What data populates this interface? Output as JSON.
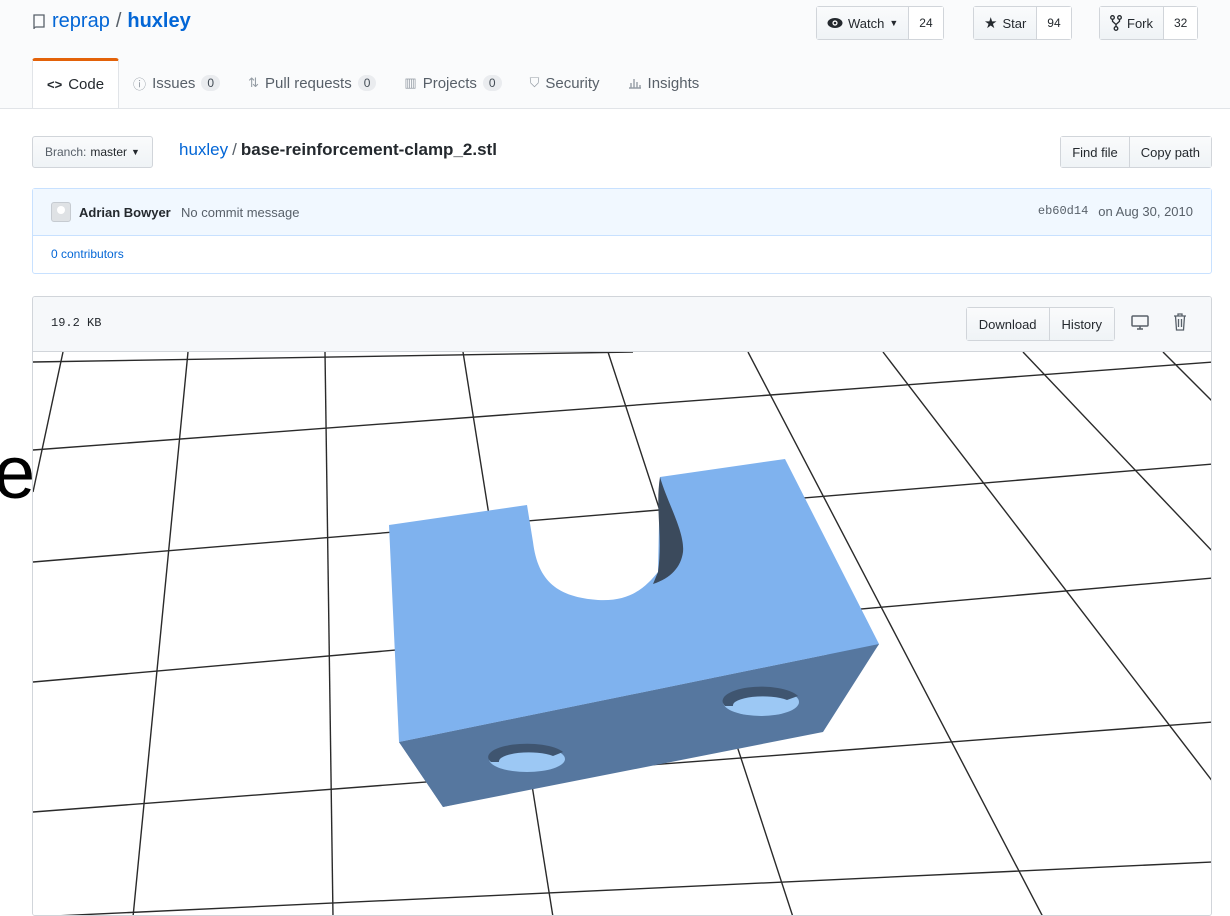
{
  "repo": {
    "owner": "reprap",
    "separator": "/",
    "name": "huxley",
    "icon": "repo-icon"
  },
  "actions": {
    "watch": {
      "label": "Watch",
      "count": "24",
      "icon": "eye-icon"
    },
    "star": {
      "label": "Star",
      "count": "94",
      "icon": "star-icon"
    },
    "fork": {
      "label": "Fork",
      "count": "32",
      "icon": "fork-icon"
    }
  },
  "tabs": [
    {
      "label": "Code",
      "icon": "code-icon",
      "selected": true
    },
    {
      "label": "Issues",
      "counter": "0",
      "icon": "issue-icon"
    },
    {
      "label": "Pull requests",
      "counter": "0",
      "icon": "pull-request-icon"
    },
    {
      "label": "Projects",
      "counter": "0",
      "icon": "project-icon"
    },
    {
      "label": "Security",
      "icon": "shield-icon"
    },
    {
      "label": "Insights",
      "icon": "graph-icon"
    }
  ],
  "branch": {
    "label": "Branch:",
    "value": "master"
  },
  "breadcrumb": {
    "root": "huxley",
    "separator": "/",
    "file": "base-reinforcement-clamp_2.stl"
  },
  "file_nav": {
    "find_file": "Find file",
    "copy_path": "Copy path"
  },
  "commit": {
    "author": "Adrian Bowyer",
    "message": "No commit message",
    "sha": "eb60d14",
    "date": "on Aug 30, 2010",
    "contributors": "0 contributors"
  },
  "file": {
    "size": "19.2 KB",
    "download": "Download",
    "history": "History",
    "desktop_icon": "desktop-icon",
    "trash_icon": "trash-icon"
  },
  "viewer": {
    "model_color": "#7fb2ee",
    "side_color": "#5a7fb0",
    "overlay_glyph": "e"
  },
  "colors": {
    "link": "#0366d6",
    "accent": "#e36209"
  }
}
